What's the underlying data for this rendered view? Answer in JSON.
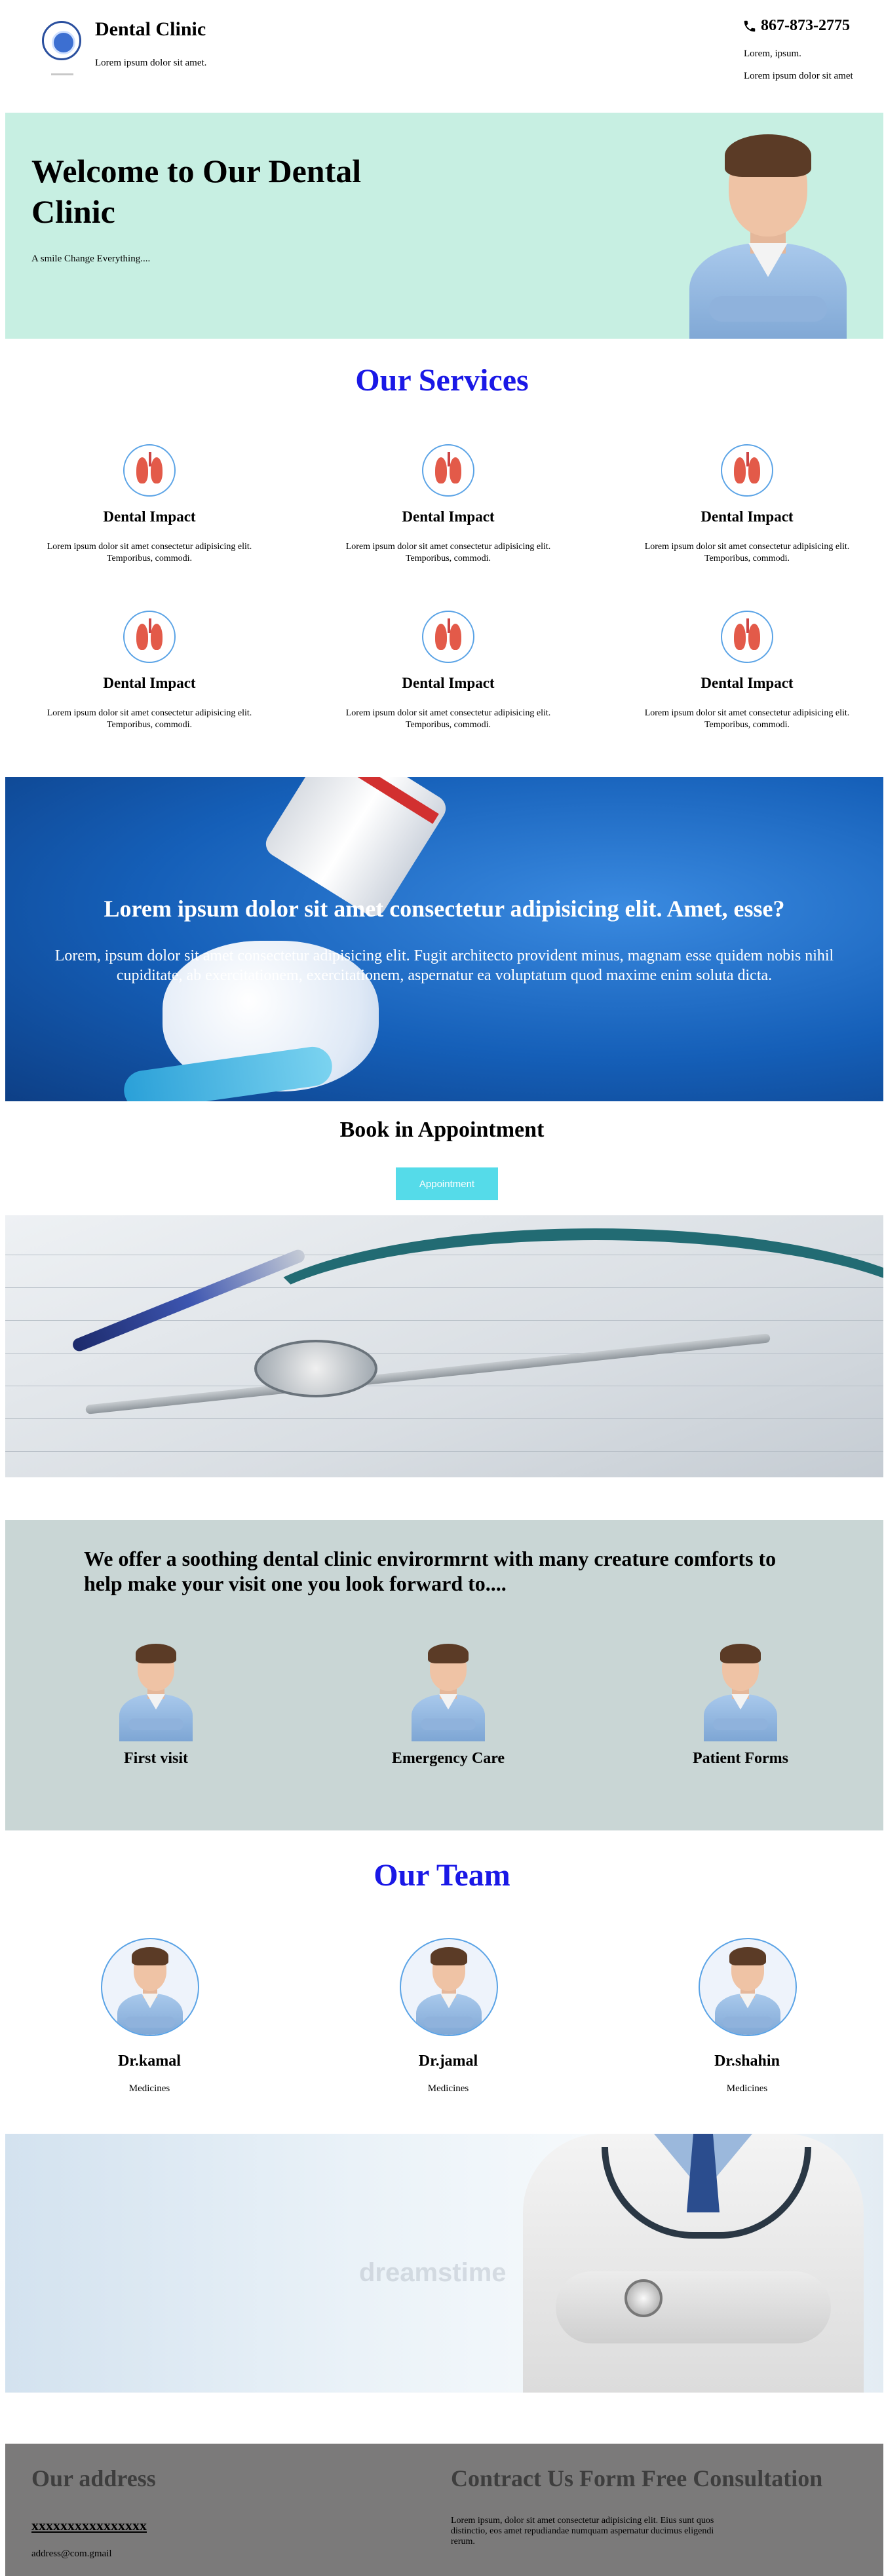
{
  "header": {
    "title": "Dental Clinic",
    "tagline": "Lorem ipsum dolor sit amet.",
    "phone": "867-873-2775",
    "contact_line1": "Lorem, ipsum.",
    "contact_line2": "Lorem ipsum dolor sit amet"
  },
  "hero": {
    "title": "Welcome to Our Dental Clinic",
    "subtitle": "A smile Change Everything....",
    "bg_color": "#c7efe2"
  },
  "services": {
    "title": "Our Services",
    "title_color": "#1a18e6",
    "items": [
      {
        "title": "Dental Impact",
        "text": "Lorem ipsum dolor sit amet consectetur adipisicing elit. Temporibus, commodi.",
        "icon": "lungs-icon"
      },
      {
        "title": "Dental Impact",
        "text": "Lorem ipsum dolor sit amet consectetur adipisicing elit. Temporibus, commodi.",
        "icon": "lungs-icon"
      },
      {
        "title": "Dental Impact",
        "text": "Lorem ipsum dolor sit amet consectetur adipisicing elit. Temporibus, commodi.",
        "icon": "lungs-icon"
      },
      {
        "title": "Dental Impact",
        "text": "Lorem ipsum dolor sit amet consectetur adipisicing elit. Temporibus, commodi.",
        "icon": "lungs-icon"
      },
      {
        "title": "Dental Impact",
        "text": "Lorem ipsum dolor sit amet consectetur adipisicing elit. Temporibus, commodi.",
        "icon": "lungs-icon"
      },
      {
        "title": "Dental Impact",
        "text": "Lorem ipsum dolor sit amet consectetur adipisicing elit. Temporibus, commodi.",
        "icon": "lungs-icon"
      }
    ]
  },
  "banner": {
    "title": "Lorem ipsum dolor sit amet consectetur adipisicing elit. Amet, esse?",
    "text": "Lorem, ipsum dolor sit amet consectetur adipisicing elit. Fugit architecto provident minus, magnam esse quidem nobis nihil cupiditate, ab exercitationem, exercitationem, aspernatur ea voluptatum quod maxime enim soluta dicta."
  },
  "appointment": {
    "title": "Book in Appointment",
    "button_label": "Appointment",
    "button_color": "#55dbe9"
  },
  "comforts": {
    "title": "We offer a soothing dental clinic envirormrnt with many creature comforts to help make your visit one you look forward to....",
    "bg_color": "#c9d6d5",
    "items": [
      {
        "label": "First visit"
      },
      {
        "label": "Emergency Care"
      },
      {
        "label": "Patient Forms"
      }
    ]
  },
  "team": {
    "title": "Our Team",
    "members": [
      {
        "name": "Dr.kamal",
        "role": "Medicines"
      },
      {
        "name": "Dr.jamal",
        "role": "Medicines"
      },
      {
        "name": "Dr.shahin",
        "role": "Medicines"
      }
    ]
  },
  "doctor_banner": {
    "watermark": "dreamstime"
  },
  "footer": {
    "address_title": "Our address",
    "address_line": "xxxxxxxxxxxxxxxx",
    "email": "address@com.gmail",
    "contact_title": "Contract Us Form Free Consultation",
    "contact_text": "Lorem ipsum, dolor sit amet consectetur adipisicing elit. Eius sunt quos distinctio, eos amet repudiandae numquam aspernatur ducimus eligendi rerum.",
    "bg_color": "#7b7a7a"
  }
}
